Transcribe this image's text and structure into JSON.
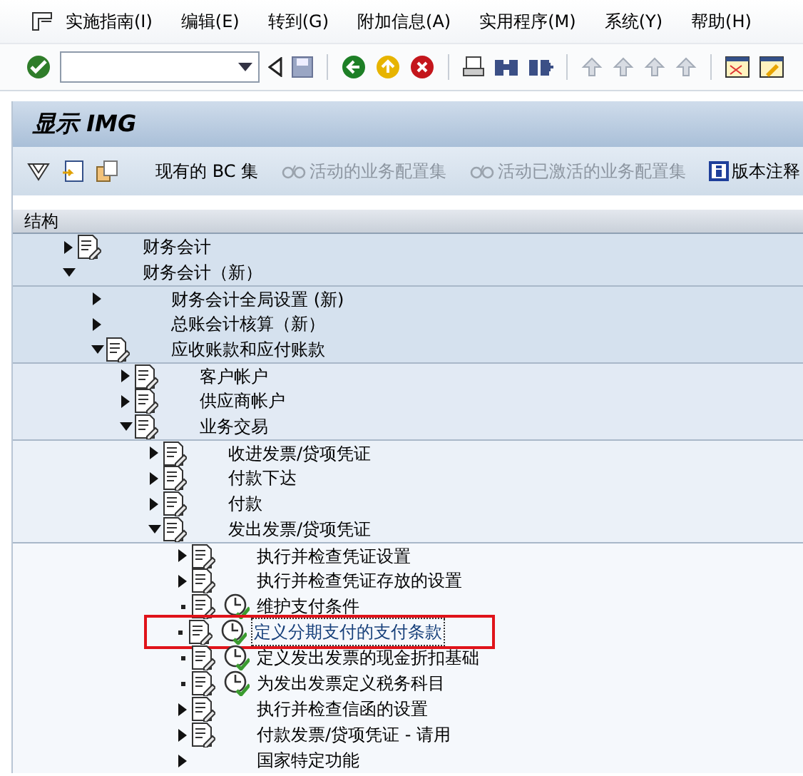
{
  "menu_bar": [
    "实施指南(I)",
    "编辑(E)",
    "转到(G)",
    "附加信息(A)",
    "实用程序(M)",
    "系统(Y)",
    "帮助(H)"
  ],
  "title": "显示 IMG",
  "app_toolbar": [
    {
      "kind": "icon"
    },
    {
      "kind": "icon"
    },
    {
      "kind": "icon"
    },
    {
      "kind": "text",
      "label": "现有的 BC 集",
      "disabled": false
    },
    {
      "kind": "glasses",
      "label": "活动的业务配置集",
      "disabled": true
    },
    {
      "kind": "glasses",
      "label": "活动已激活的业务配置集",
      "disabled": true
    },
    {
      "kind": "info",
      "label": "版本注释",
      "disabled": false
    }
  ],
  "tree_header": "结构",
  "tree": [
    {
      "text": "财务会计",
      "kind": "node",
      "expanded": false,
      "doc": true,
      "clock": false,
      "selected": false,
      "highlighted": false
    },
    {
      "text": "财务会计（新）",
      "kind": "node",
      "expanded": true,
      "doc": false,
      "clock": false,
      "selected": false,
      "highlighted": false,
      "children": [
        {
          "text": "财务会计全局设置 (新)",
          "kind": "node",
          "expanded": false,
          "doc": false,
          "clock": false,
          "selected": false,
          "highlighted": false
        },
        {
          "text": "总账会计核算（新）",
          "kind": "node",
          "expanded": false,
          "doc": false,
          "clock": false,
          "selected": false,
          "highlighted": false
        },
        {
          "text": "应收账款和应付账款",
          "kind": "node",
          "expanded": true,
          "doc": true,
          "clock": false,
          "selected": false,
          "highlighted": false,
          "children": [
            {
              "text": "客户帐户",
              "kind": "node",
              "expanded": false,
              "doc": true,
              "clock": false,
              "selected": false,
              "highlighted": false
            },
            {
              "text": "供应商帐户",
              "kind": "node",
              "expanded": false,
              "doc": true,
              "clock": false,
              "selected": false,
              "highlighted": false
            },
            {
              "text": "业务交易",
              "kind": "node",
              "expanded": true,
              "doc": true,
              "clock": false,
              "selected": false,
              "highlighted": false,
              "children": [
                {
                  "text": "收进发票/贷项凭证",
                  "kind": "node",
                  "expanded": false,
                  "doc": true,
                  "clock": false,
                  "selected": false,
                  "highlighted": false
                },
                {
                  "text": "付款下达",
                  "kind": "node",
                  "expanded": false,
                  "doc": true,
                  "clock": false,
                  "selected": false,
                  "highlighted": false
                },
                {
                  "text": "付款",
                  "kind": "node",
                  "expanded": false,
                  "doc": true,
                  "clock": false,
                  "selected": false,
                  "highlighted": false
                },
                {
                  "text": "发出发票/贷项凭证",
                  "kind": "node",
                  "expanded": true,
                  "doc": true,
                  "clock": false,
                  "selected": false,
                  "highlighted": false,
                  "children": [
                    {
                      "text": "执行并检查凭证设置",
                      "kind": "node",
                      "expanded": false,
                      "doc": true,
                      "clock": false,
                      "selected": false,
                      "highlighted": false
                    },
                    {
                      "text": "执行并检查凭证存放的设置",
                      "kind": "node",
                      "expanded": false,
                      "doc": true,
                      "clock": false,
                      "selected": false,
                      "highlighted": false
                    },
                    {
                      "text": "维护支付条件",
                      "kind": "leaf",
                      "doc": true,
                      "clock": true,
                      "selected": false,
                      "highlighted": false
                    },
                    {
                      "text": "定义分期支付的支付条款",
                      "kind": "leaf",
                      "doc": true,
                      "clock": true,
                      "selected": true,
                      "highlighted": true
                    },
                    {
                      "text": "定义发出发票的现金折扣基础",
                      "kind": "leaf",
                      "doc": true,
                      "clock": true,
                      "selected": false,
                      "highlighted": false
                    },
                    {
                      "text": "为发出发票定义税务科目",
                      "kind": "leaf",
                      "doc": true,
                      "clock": true,
                      "selected": false,
                      "highlighted": false
                    },
                    {
                      "text": "执行并检查信函的设置",
                      "kind": "node",
                      "expanded": false,
                      "doc": true,
                      "clock": false,
                      "selected": false,
                      "highlighted": false
                    },
                    {
                      "text": "付款发票/贷项凭证 - 请用",
                      "kind": "node",
                      "expanded": false,
                      "doc": true,
                      "clock": false,
                      "selected": false,
                      "highlighted": false
                    },
                    {
                      "text": "国家特定功能",
                      "kind": "node",
                      "expanded": false,
                      "doc": false,
                      "clock": false,
                      "selected": false,
                      "highlighted": false
                    }
                  ]
                }
              ]
            }
          ]
        }
      ]
    }
  ]
}
